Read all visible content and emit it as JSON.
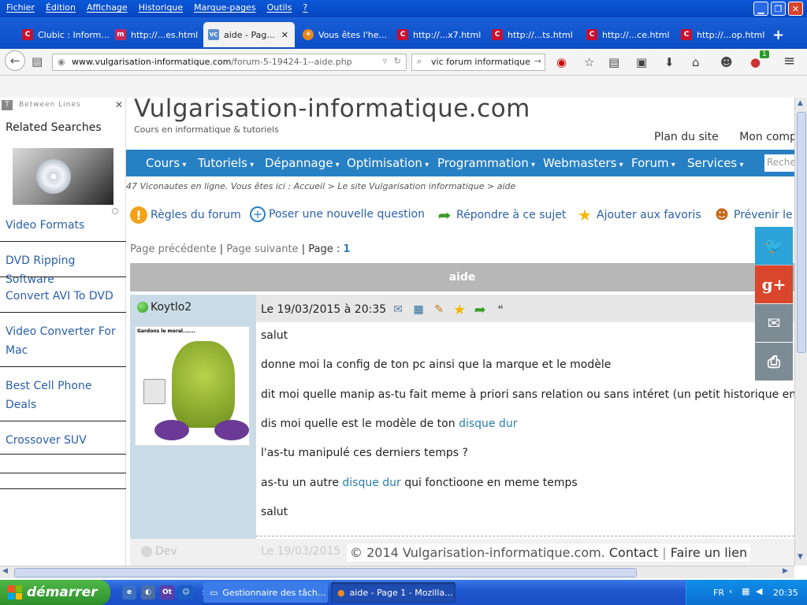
{
  "menu": [
    "Fichier",
    "Édition",
    "Affichage",
    "Historique",
    "Marque-pages",
    "Outils",
    "?"
  ],
  "tabs": [
    {
      "label": "Clubic : Inform...",
      "icon": "C"
    },
    {
      "label": "http://...es.html",
      "icon": "m"
    },
    {
      "label": "aide - Pag...",
      "icon": "VC",
      "active": true
    },
    {
      "label": "Vous êtes l'he...",
      "icon": "sun"
    },
    {
      "label": "http://...x7.html",
      "icon": "C"
    },
    {
      "label": "http://...ts.html",
      "icon": "C"
    },
    {
      "label": "http://...ce.html",
      "icon": "C"
    },
    {
      "label": "http://...op.html",
      "icon": "C"
    }
  ],
  "url": {
    "domain": "www.vulgarisation-informatique.com",
    "path": "/forum-5-19424-1--aide.php"
  },
  "search_query": "vic forum informatique",
  "badge_count": "1",
  "sidebar": {
    "brand": "Between Lines",
    "title": "Related Searches",
    "links": [
      "Video Formats",
      "DVD Ripping Software",
      "Convert AVI To DVD",
      "Video Converter For Mac",
      "Best Cell Phone Deals",
      "Crossover SUV"
    ]
  },
  "site": {
    "logo": "Vulgarisation-informatique.com",
    "tagline": "Cours en informatique & tutoriels",
    "top_links": [
      "Plan du site",
      "Mon comp"
    ],
    "nav": [
      "Cours",
      "Tutoriels",
      "Dépannage",
      "Optimisation",
      "Programmation",
      "Webmasters",
      "Forum",
      "Services"
    ],
    "nav_search_placeholder": "Reche",
    "breadcrumb": "47 Viconautes en ligne. Vous êtes ici :  Accueil > Le site Vulgarisation informatique > aide"
  },
  "actions": [
    "Règles du forum",
    "Poser une nouvelle question",
    "Répondre à ce sujet",
    "Ajouter aux favoris",
    "Prévenir le"
  ],
  "pager": {
    "prev": "Page précédente",
    "next": "Page suivante",
    "label": "Page :",
    "current": "1"
  },
  "thread_title": "aide",
  "post": {
    "author": "Koytlo2",
    "avatar_caption": "Gardons le moral.......",
    "date": "Le 19/03/2015 à 20:35",
    "lines": [
      "salut",
      "donne moi la config de ton pc ainsi que la marque et le modèle",
      "dit moi quelle manip as-tu fait meme à priori sans relation ou sans intéret (un petit historique en",
      "dis moi quelle est le modèle de ton",
      "l'as-tu manipulé ces derniers temps ?",
      "as-tu un autre",
      "salut"
    ],
    "link_text": "disque dur",
    "line6_tail": "qui fonctioone en meme temps"
  },
  "next_post": {
    "author": "Dev",
    "date": "Le 19/03/2015"
  },
  "footer": {
    "copyright": "© 2014 Vulgarisation-informatique.com.",
    "contact": "Contact",
    "sep": "|",
    "link": "Faire un lien"
  },
  "share": [
    {
      "name": "twitter",
      "color": "#2ba3d8",
      "glyph": "t"
    },
    {
      "name": "googleplus",
      "color": "#d9462c",
      "glyph": "g+"
    },
    {
      "name": "email",
      "color": "#7d8b94",
      "glyph": "✉"
    },
    {
      "name": "print",
      "color": "#7d8b94",
      "glyph": "⎙"
    }
  ],
  "taskbar": {
    "start": "démarrer",
    "tasks": [
      "Gestionnaire des tâch...",
      "aide - Page 1 - Mozilla..."
    ],
    "lang": "FR",
    "time": "20:35"
  }
}
